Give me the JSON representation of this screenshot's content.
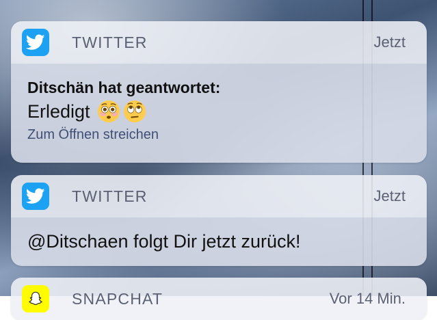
{
  "notifications": [
    {
      "app_name": "TWITTER",
      "app_icon": "twitter-bird-icon",
      "time": "Jetzt",
      "title": "Ditschän hat geantwortet:",
      "message": "Erledigt",
      "message_emojis": [
        "flushed-face-emoji",
        "face-with-rolling-eyes-emoji"
      ],
      "hint": "Zum Öffnen streichen"
    },
    {
      "app_name": "TWITTER",
      "app_icon": "twitter-bird-icon",
      "time": "Jetzt",
      "message": "@Ditschaen folgt Dir jetzt zurück!"
    },
    {
      "app_name": "SNAPCHAT",
      "app_icon": "snapchat-ghost-icon",
      "time": "Vor 14 Min."
    }
  ],
  "colors": {
    "twitter_blue": "#1da1f2",
    "snapchat_yellow": "#fffc00",
    "hint_text": "#3f4f75"
  }
}
